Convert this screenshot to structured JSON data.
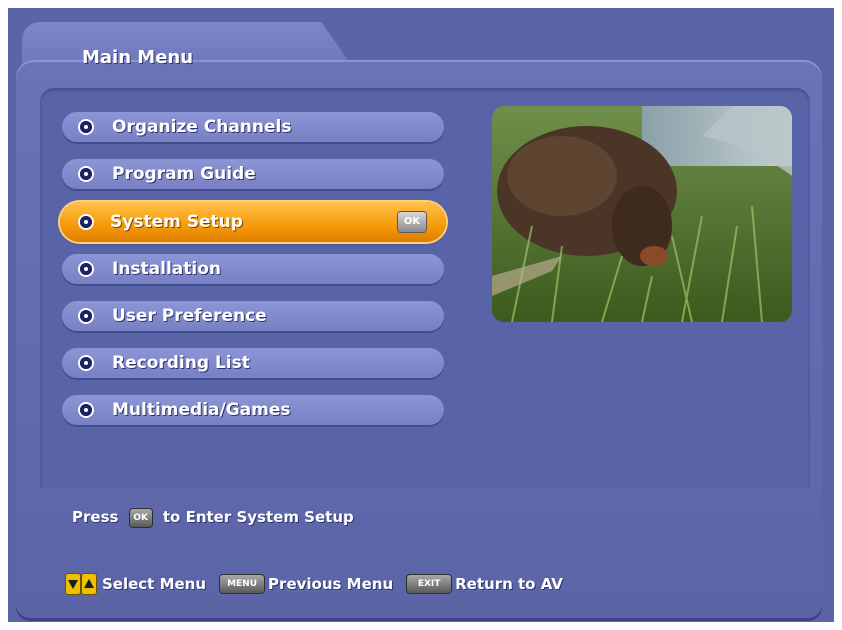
{
  "title": "Main Menu",
  "menu": [
    {
      "label": "Organize Channels"
    },
    {
      "label": "Program Guide"
    },
    {
      "label": "System Setup",
      "selected": true,
      "badge": "OK"
    },
    {
      "label": "Installation"
    },
    {
      "label": "User Preference"
    },
    {
      "label": "Recording List"
    },
    {
      "label": "Multimedia/Games"
    }
  ],
  "hint": {
    "prefix": "Press",
    "key": "OK",
    "suffix": "to Enter System Setup"
  },
  "footer": {
    "select_label": "Select Menu",
    "menu_key": "MENU",
    "previous_label": "Previous Menu",
    "exit_key": "EXIT",
    "return_label": "Return to AV"
  },
  "colors": {
    "background": "#5b64a6",
    "selected": "#f59a08",
    "text": "#ffffff"
  },
  "icons": [
    "menu-bullet-icon",
    "arrow-down-icon",
    "arrow-up-icon"
  ]
}
